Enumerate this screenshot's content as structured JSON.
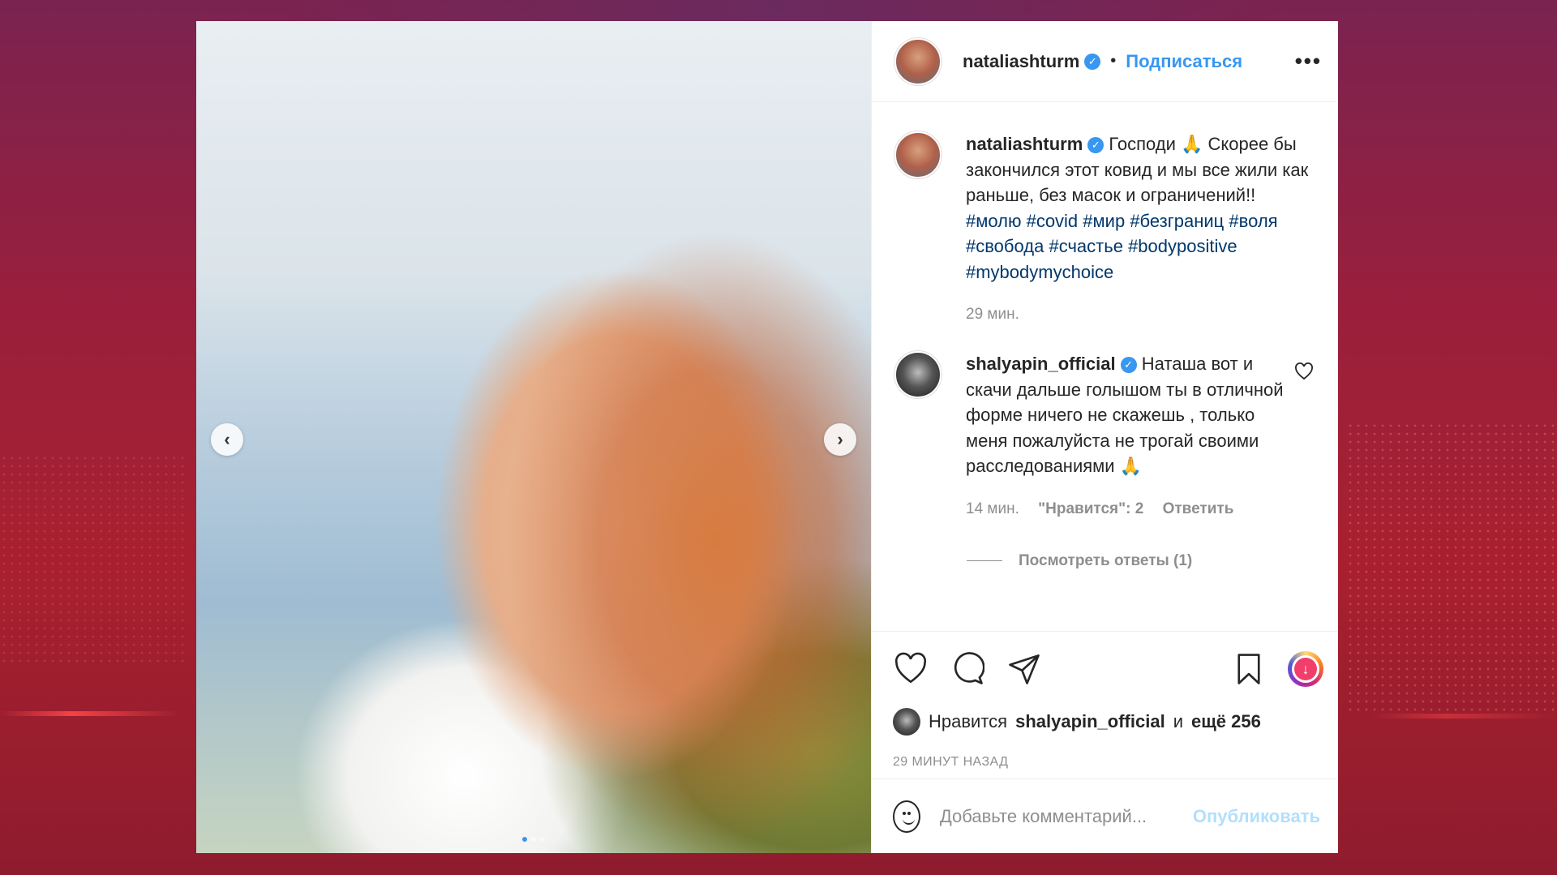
{
  "post": {
    "author": "nataliashturm",
    "verified_mark": "✓",
    "dot": "•",
    "follow_label": "Подписаться",
    "more_label": "•••",
    "prev_arrow": "‹",
    "next_arrow": "›",
    "carousel": {
      "count": 3,
      "active": 1
    }
  },
  "caption": {
    "author": "nataliashturm",
    "text_before_hashtags": "Господи 🙏 Скорее бы закончился этот ковид и мы все жили как раньше, без масок и ограничений!!",
    "hashtags": [
      "#молю",
      "#covid",
      "#мир",
      "#безграниц",
      "#воля",
      "#свобода",
      "#счастье",
      "#bodypositive",
      "#mybodymychoice"
    ],
    "time": "29 мин."
  },
  "comment": {
    "author": "shalyapin_official",
    "text": "Наташа вот и скачи дальше голышом ты в отличной форме ничего не скажешь , только меня пожалуйста не трогай своими расследованиями 🙏",
    "time": "14 мин.",
    "likes": "\"Нравится\": 2",
    "reply_label": "Ответить",
    "view_replies": "Посмотреть ответы (1)",
    "heart_icon": "heart-outline-icon"
  },
  "likes_line": {
    "prefix": "Нравится",
    "user": "shalyapin_official",
    "conj": "и",
    "rest": "ещё 256"
  },
  "posted_ago": "29 МИНУТ НАЗАД",
  "add_comment": {
    "placeholder": "Добавьте комментарий...",
    "publish_label": "Опубликовать"
  },
  "colors": {
    "accent": "#3897f0",
    "background": "#9a1f3c",
    "muted_text": "#8e8e8e"
  }
}
